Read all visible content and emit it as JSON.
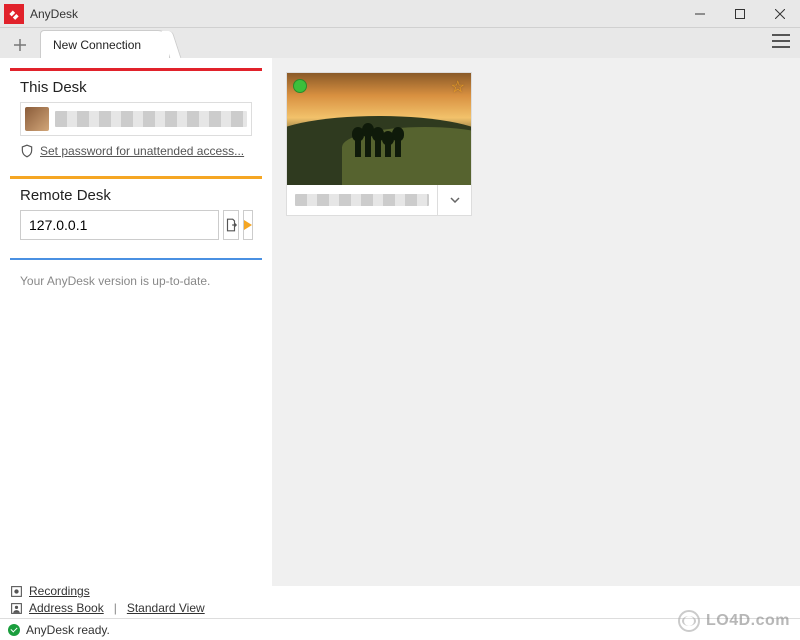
{
  "window": {
    "title": "AnyDesk"
  },
  "tabs": {
    "active": "New Connection"
  },
  "this_desk": {
    "heading": "This Desk",
    "unattended_link": "Set password for unattended access..."
  },
  "remote_desk": {
    "heading": "Remote Desk",
    "address_value": "127.0.0.1"
  },
  "update": {
    "message": "Your AnyDesk version is up-to-date."
  },
  "recent": {
    "items": [
      {
        "label_redacted": true
      }
    ]
  },
  "bottom_links": {
    "recordings": "Recordings",
    "address_book": "Address Book",
    "standard_view": "Standard View"
  },
  "status": {
    "text": "AnyDesk ready."
  },
  "watermark": "LO4D.com"
}
